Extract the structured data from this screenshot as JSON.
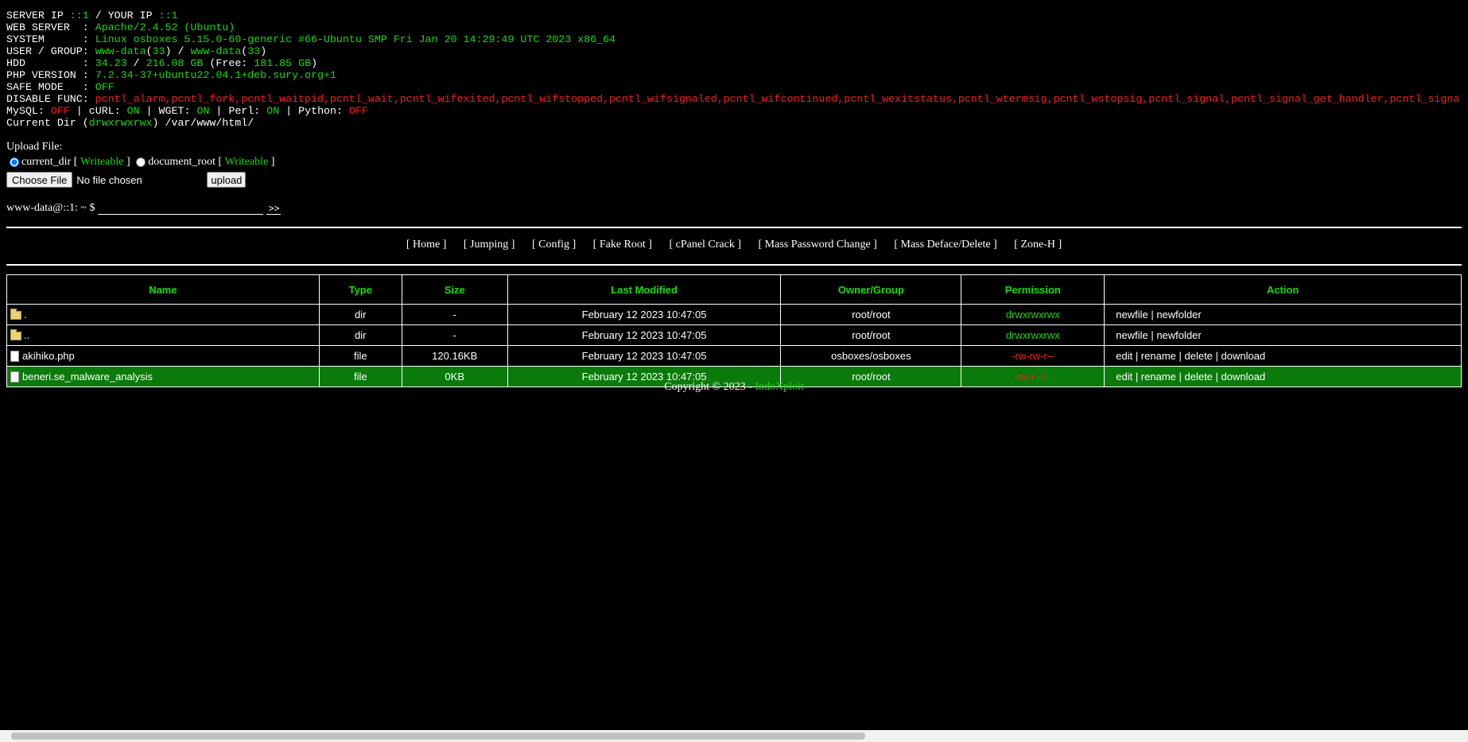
{
  "info": {
    "server_ip_label": "SERVER IP ",
    "server_ip": "::1",
    "your_ip_label": " / YOUR IP ",
    "your_ip": "::1",
    "web_server_label": "WEB SERVER  : ",
    "web_server": "Apache/2.4.52 (Ubuntu)",
    "system_label": "SYSTEM      : ",
    "system": "Linux osboxes 5.15.0-60-generic #66-Ubuntu SMP Fri Jan 20 14:29:49 UTC 2023 x86_64",
    "user_label": "USER / GROUP: ",
    "user": "www-data",
    "user_id": "33",
    "group": "www-data",
    "group_id": "33",
    "hdd_label": "HDD         : ",
    "hdd_used": "34.23",
    "hdd_total": "216.08 GB",
    "hdd_free_label": "Free: ",
    "hdd_free": "181.85 GB",
    "php_label": "PHP VERSION : ",
    "php": "7.2.34-37+ubuntu22.04.1+deb.sury.org+1",
    "safe_mode_label": "SAFE MODE   : ",
    "safe_mode": "OFF",
    "disable_func_label": "DISABLE FUNC: ",
    "disable_func": "pcntl_alarm,pcntl_fork,pcntl_waitpid,pcntl_wait,pcntl_wifexited,pcntl_wifstopped,pcntl_wifsignaled,pcntl_wifcontinued,pcntl_wexitstatus,pcntl_wtermsig,pcntl_wstopsig,pcntl_signal,pcntl_signal_get_handler,pcntl_signal_dispatch",
    "mysql_label": "MySQL: ",
    "mysql": "OFF",
    "curl_label": " | cURL: ",
    "curl": "ON",
    "wget_label": " | WGET: ",
    "wget": "ON",
    "perl_label": " | Perl: ",
    "perl": "ON",
    "python_label": " | Python: ",
    "python": "OFF",
    "current_dir_label": "Current Dir (",
    "current_dir_perm": "drwxrwxrwx",
    "current_dir_path": ") /var/www/html/"
  },
  "upload": {
    "title": "Upload File:",
    "opt1_label": "current_dir",
    "opt1_status": "Writeable",
    "opt2_label": "document_root",
    "opt2_status": "Writeable",
    "choose_label": "Choose File",
    "no_file": "No file chosen",
    "upload_label": "upload"
  },
  "cmd": {
    "prompt": "www-data@::1: ~ $",
    "go_label": ">>"
  },
  "nav": [
    "[ Home ]",
    "[ Jumping ]",
    "[ Config ]",
    "[ Fake Root ]",
    "[ cPanel Crack ]",
    "[ Mass Password Change ]",
    "[ Mass Deface/Delete ]",
    "[ Zone-H ]"
  ],
  "table": {
    "headers": [
      "Name",
      "Type",
      "Size",
      "Last Modified",
      "Owner/Group",
      "Permission",
      "Action"
    ],
    "rows": [
      {
        "name": ".",
        "type": "dir",
        "size": "-",
        "modified": "February 12 2023 10:47:05",
        "owner": "root/root",
        "perm": "drwxrwxrwx",
        "action": "newfile | newfolder"
      },
      {
        "name": "..",
        "type": "dir",
        "size": "-",
        "modified": "February 12 2023 10:47:05",
        "owner": "root/root",
        "perm": "drwxrwxrwx",
        "action": "newfile | newfolder"
      },
      {
        "name": "akihiko.php",
        "type": "file",
        "size": "120.16KB",
        "modified": "February 12 2023 10:47:05",
        "owner": "osboxes/osboxes",
        "perm": "-rw-rw-r--",
        "action": "edit | rename | delete | download"
      },
      {
        "name": "beneri.se_malware_analysis",
        "type": "file",
        "size": "0KB",
        "modified": "February 12 2023 10:47:05",
        "owner": "root/root",
        "perm": "-rw-r--r--",
        "action": "edit | rename | delete | download"
      }
    ]
  },
  "footer": {
    "text": "Copyright © 2023 - ",
    "brand": "IndoXploit"
  },
  "colors": {
    "background": "#000000",
    "green": "#1bd80f",
    "red": "#ff1b1b",
    "selected_row": "#0a7a0a"
  }
}
